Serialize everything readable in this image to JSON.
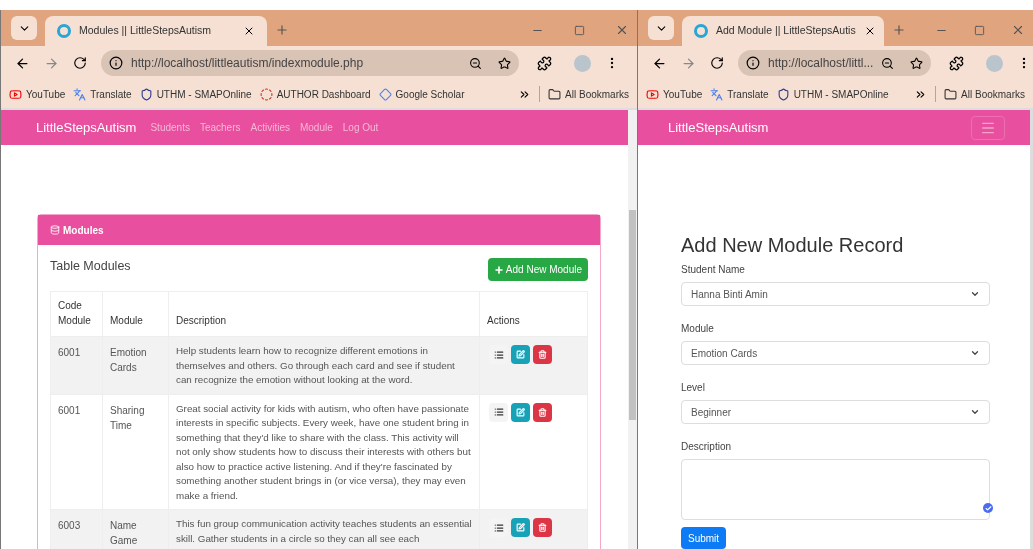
{
  "left_window": {
    "tab_title": "Modules || LittleStepsAutism",
    "url": "http://localhost/littleautism/indexmodule.php",
    "bookmarks": [
      {
        "kind": "video",
        "label": "YouTube"
      },
      {
        "kind": "translate",
        "label": "Translate"
      },
      {
        "kind": "shield",
        "label": "UTHM - SMAPOnline"
      },
      {
        "kind": "author",
        "label": "AUTHOR Dashboard"
      },
      {
        "kind": "scholar",
        "label": "Google Scholar"
      }
    ],
    "all_bookmarks": "All Bookmarks",
    "navbar": {
      "brand": "LittleStepsAutism",
      "links": [
        "Students",
        "Teachers",
        "Activities",
        "Module",
        "Log Out"
      ]
    },
    "card": {
      "header": "Modules",
      "title": "Table Modules",
      "add_button": "Add New Module",
      "columns": [
        "Code Module",
        "Module",
        "Description",
        "Actions"
      ],
      "rows": [
        {
          "code": "6001",
          "module": "Emotion Cards",
          "description": "Help students learn how to recognize different emotions in themselves and others. Go through each card and see if student can recognize the emotion without looking at the word."
        },
        {
          "code": "6001",
          "module": "Sharing Time",
          "description": "Great social activity for kids with autism, who often have passionate interests in specific subjects. Every week, have one student bring in something that they'd like to share with the class. This activity will not only show students how to discuss their interests with others but also how to practice active listening. And if they're fascinated by something another student brings in (or vice versa), they may even make a friend."
        },
        {
          "code": "6003",
          "module": "Name Game",
          "description": "This fun group communication activity teaches students an essential skill. Gather students in a circle so they can all see each"
        }
      ]
    }
  },
  "right_window": {
    "tab_title": "Add Module || LittleStepsAutis",
    "url": "http://localhost/littl...",
    "bookmarks": [
      {
        "kind": "video",
        "label": "YouTube"
      },
      {
        "kind": "translate",
        "label": "Translate"
      },
      {
        "kind": "shield",
        "label": "UTHM - SMAPOnline"
      }
    ],
    "all_bookmarks": "All Bookmarks",
    "navbar": {
      "brand": "LittleStepsAutism"
    },
    "form": {
      "heading": "Add New Module Record",
      "fields": [
        {
          "kind": "select",
          "label": "Student Name",
          "value": "Hanna Binti Amin"
        },
        {
          "kind": "select",
          "label": "Module",
          "value": "Emotion Cards"
        },
        {
          "kind": "select",
          "label": "Level",
          "value": "Beginner"
        },
        {
          "kind": "textarea",
          "label": "Description"
        }
      ],
      "submit": "Submit"
    }
  }
}
